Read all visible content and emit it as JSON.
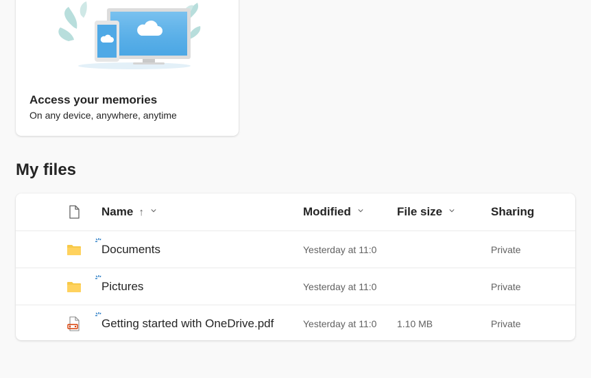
{
  "promo_card": {
    "title": "Access your memories",
    "subtitle": "On any device, anywhere, anytime"
  },
  "section": {
    "title": "My files"
  },
  "table": {
    "columns": {
      "name": "Name",
      "sort_arrow": "↑",
      "modified": "Modified",
      "file_size": "File size",
      "sharing": "Sharing"
    },
    "rows": [
      {
        "name": "Documents",
        "modified": "Yesterday at 11:0",
        "size": "",
        "sharing": "Private",
        "icon": "folder-icon"
      },
      {
        "name": "Pictures",
        "modified": "Yesterday at 11:0",
        "size": "",
        "sharing": "Private",
        "icon": "folder-icon"
      },
      {
        "name": "Getting started with OneDrive.pdf",
        "modified": "Yesterday at 11:0",
        "size": "1.10 MB",
        "sharing": "Private",
        "icon": "pdf-icon"
      }
    ]
  },
  "colors": {
    "accent": "#0f6cbd",
    "folder": "#ffd25e",
    "pdf": "#d83b01",
    "background": "#f9f9f9"
  }
}
